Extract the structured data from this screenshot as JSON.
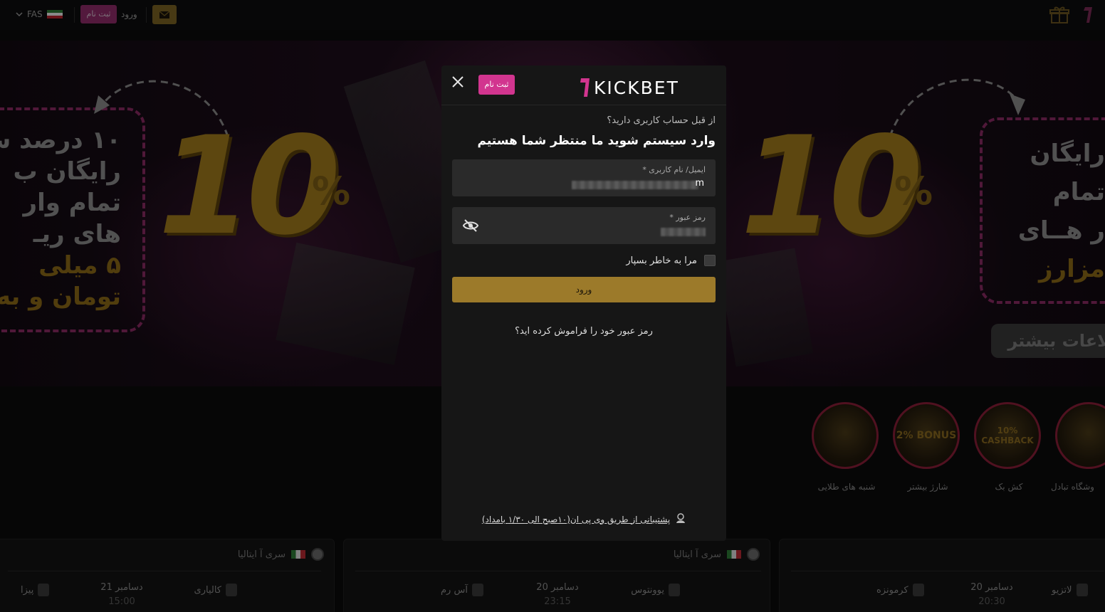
{
  "topbar": {
    "language": "FAS",
    "register_label": "ثبت نام",
    "login_label": "ورود",
    "icons": [
      "chevron-down-icon",
      "iran-flag-icon",
      "mail-icon",
      "gift-icon",
      "brand-logo-icon"
    ]
  },
  "hero": {
    "big_number_left": "10",
    "big_number_right": "10",
    "percent": "%",
    "left_promo_lines": [
      "۱۰ درصد ش",
      "رایگان ب",
      "تمام وار",
      "های ریـ",
      "۵ میلی",
      "تومان و به"
    ],
    "right_promo_lines": [
      "رایگان",
      "تمام",
      "ر هــای",
      "مزارز"
    ],
    "more_info_label": "طلاعات بیشتر"
  },
  "promotions": [
    {
      "label": "شنبه های طلایی",
      "badge": ""
    },
    {
      "label": "شارژ بیشتر",
      "badge": "2% BONUS"
    },
    {
      "label": "کش بک",
      "badge": "10% CASHBACK"
    },
    {
      "label": "وشگاه تبادل",
      "badge": ""
    }
  ],
  "matches": [
    {
      "league": "سری آ ایتالیا",
      "home": "کالیاری",
      "away": "پیزا",
      "date": "دسامبر 21",
      "time": "15:00"
    },
    {
      "league": "سری آ ایتالیا",
      "home": "یوونتوس",
      "away": "آس رم",
      "date": "دسامبر 20",
      "time": "23:15"
    },
    {
      "league": "",
      "home": "لاتزیو",
      "away": "کرمونزه",
      "date": "دسامبر 20",
      "time": "20:30"
    }
  ],
  "modal": {
    "brand": "1KICKBET",
    "register_label": "ثبت نام",
    "question": "از قبل حساب کاربری دارید؟",
    "heading": "وارد سیستم شوید ما منتظر شما هستیم",
    "email_label": "ایمیل/ نام کاربری *",
    "email_value_tail": "m",
    "password_label": "رمز عبور *",
    "remember_label": "مرا به خاطر بسپار",
    "submit_label": "ورود",
    "forgot_label": "رمز عبور خود را فراموش کرده اید؟",
    "support_label": "پشتیبانی از طریق وی پی ان(۱۰صبح الی ۱/۳۰ بامداد)"
  },
  "colors": {
    "accent_pink": "#d2358f",
    "accent_gold": "#9c7a2a",
    "modal_bg": "#161616",
    "field_bg": "#2a2a2a"
  }
}
